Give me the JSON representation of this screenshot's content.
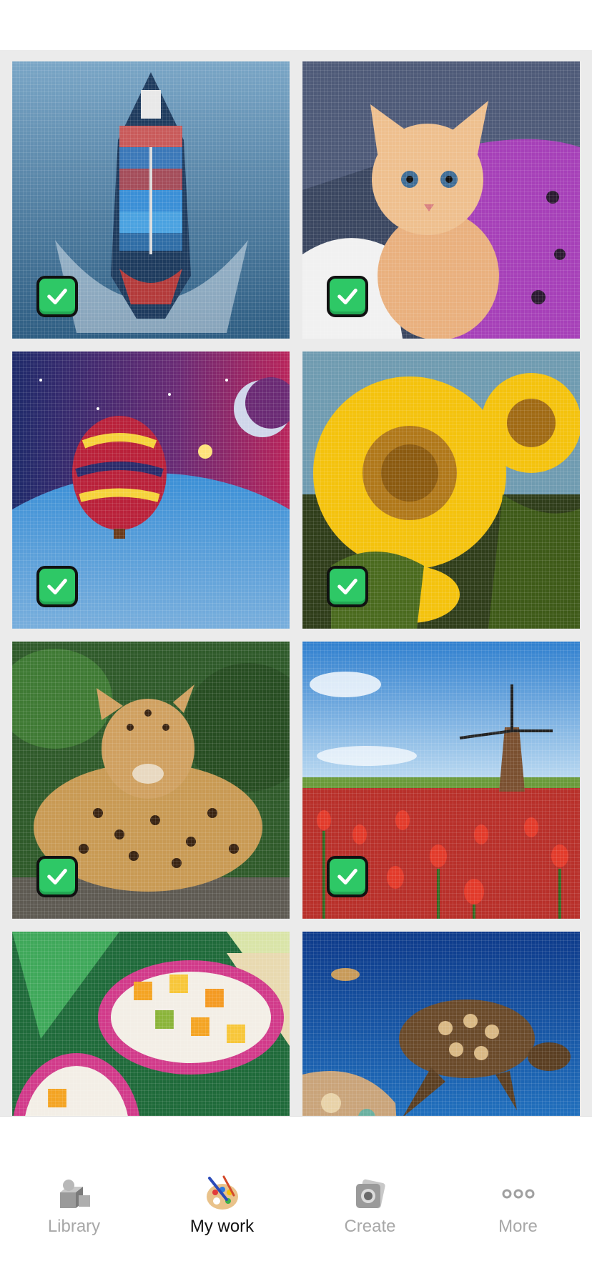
{
  "gallery": {
    "items": [
      {
        "id": "ship",
        "completed": true
      },
      {
        "id": "kitten",
        "completed": true
      },
      {
        "id": "balloon",
        "completed": true
      },
      {
        "id": "sunflower",
        "completed": true
      },
      {
        "id": "leopard",
        "completed": true
      },
      {
        "id": "windmill",
        "completed": true
      },
      {
        "id": "fruit",
        "completed": false
      },
      {
        "id": "turtle",
        "completed": false
      }
    ],
    "badge_color": "#2ec866"
  },
  "tabbar": {
    "tabs": [
      {
        "label": "Library",
        "icon": "library-icon",
        "active": false
      },
      {
        "label": "My work",
        "icon": "palette-icon",
        "active": true
      },
      {
        "label": "Create",
        "icon": "camera-icon",
        "active": false
      },
      {
        "label": "More",
        "icon": "more-icon",
        "active": false
      }
    ],
    "active_color": "#111111",
    "inactive_color": "#a8a8a8"
  }
}
